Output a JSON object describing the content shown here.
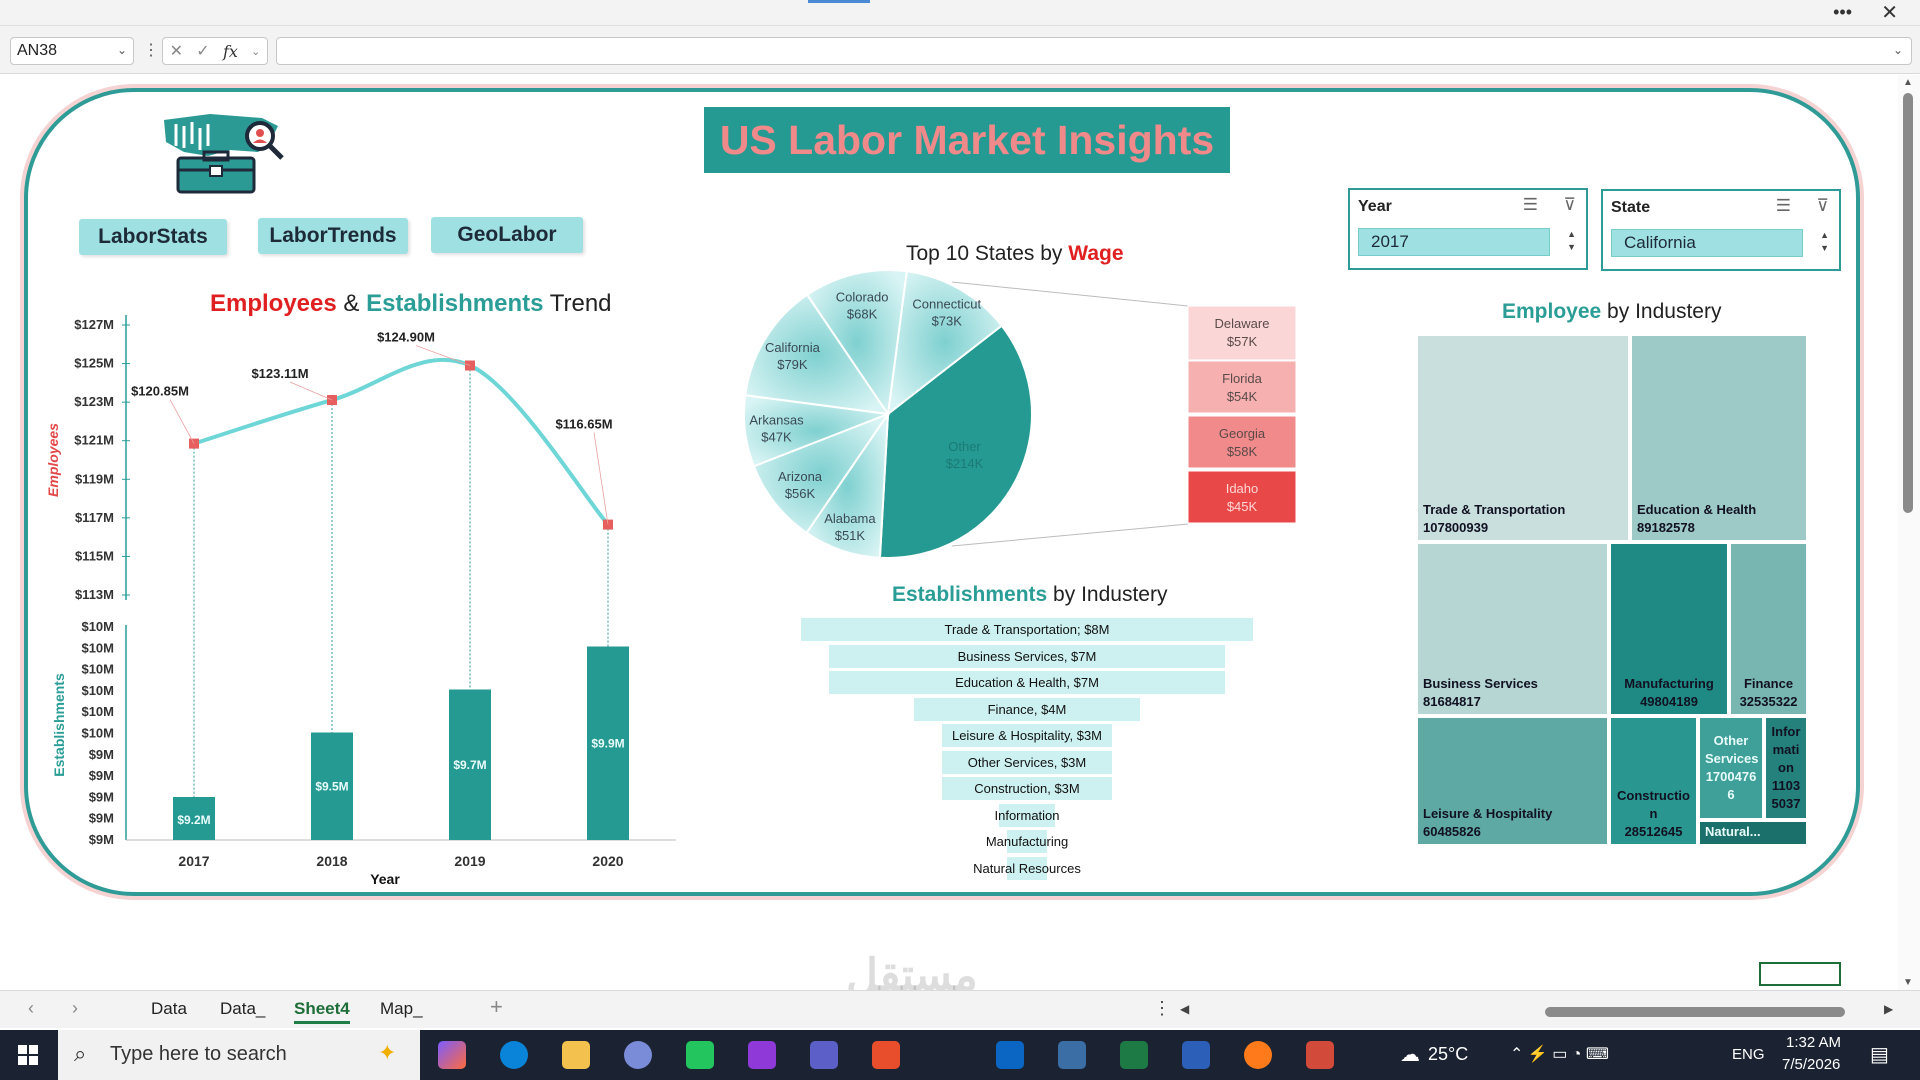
{
  "formula_bar": {
    "name_box": "AN38",
    "fx": "fx"
  },
  "dashboard": {
    "title": "US Labor Market Insights",
    "nav_buttons": [
      "LaborStats",
      "LaborTrends",
      "GeoLabor"
    ],
    "trend_title": {
      "part1": "Employees",
      "amp": " & ",
      "part2": "Establishments",
      "part3": " Trend"
    },
    "pie_title": {
      "part1": "Top 10 States by ",
      "part2": "Wage"
    },
    "funnel_title": {
      "part1": "Establishments",
      "part2": " by Industery"
    },
    "treemap_title": {
      "part1": "Employee",
      "part2": " by Industery"
    },
    "slicers": {
      "year": {
        "label": "Year",
        "value": "2017"
      },
      "state": {
        "label": "State",
        "value": "California"
      }
    }
  },
  "chart_data": [
    {
      "type": "line",
      "title": "Employees & Establishments Trend",
      "xlabel": "Year",
      "ylabel": "Employees",
      "categories": [
        "2017",
        "2018",
        "2019",
        "2020"
      ],
      "values": [
        120.85,
        123.11,
        124.9,
        116.65
      ],
      "data_labels": [
        "$120.85M",
        "$123.11M",
        "$124.90M",
        "$116.65M"
      ],
      "ylim": [
        113,
        127
      ],
      "y_ticks": [
        "$127M",
        "$125M",
        "$123M",
        "$121M",
        "$119M",
        "$117M",
        "$115M",
        "$113M"
      ]
    },
    {
      "type": "bar",
      "xlabel": "Year",
      "ylabel": "Establishments",
      "categories": [
        "2017",
        "2018",
        "2019",
        "2020"
      ],
      "values": [
        9.2,
        9.5,
        9.7,
        9.9
      ],
      "data_labels": [
        "$9.2M",
        "$9.5M",
        "$9.7M",
        "$9.9M"
      ],
      "ylim": [
        9.0,
        10.0
      ],
      "y_ticks": [
        "$10M",
        "$10M",
        "$10M",
        "$10M",
        "$10M",
        "$10M",
        "$9M",
        "$9M",
        "$9M",
        "$9M",
        "$9M"
      ]
    },
    {
      "type": "pie",
      "title": "Top 10 States by Wage",
      "slices": [
        {
          "label": "Connecticut",
          "value_label": "$73K",
          "value": 73
        },
        {
          "label": "Other",
          "value_label": "$214K",
          "value": 214
        },
        {
          "label": "Alabama",
          "value_label": "$51K",
          "value": 51
        },
        {
          "label": "Arizona",
          "value_label": "$56K",
          "value": 56
        },
        {
          "label": "Arkansas",
          "value_label": "$47K",
          "value": 47
        },
        {
          "label": "California",
          "value_label": "$79K",
          "value": 79
        },
        {
          "label": "Colorado",
          "value_label": "$68K",
          "value": 68
        }
      ],
      "other_breakdown": [
        {
          "label": "Delaware",
          "value_label": "$57K",
          "value": 57,
          "color": "#fbd6d6"
        },
        {
          "label": "Florida",
          "value_label": "$54K",
          "value": 54,
          "color": "#f7b0b0"
        },
        {
          "label": "Georgia",
          "value_label": "$58K",
          "value": 58,
          "color": "#f18a8a"
        },
        {
          "label": "Idaho",
          "value_label": "$45K",
          "value": 45,
          "color": "#e94848"
        }
      ]
    },
    {
      "type": "bar",
      "title": "Establishments by Industery",
      "items": [
        {
          "label": "Trade & Transportation; $8M",
          "value": 8
        },
        {
          "label": "Business Services, $7M",
          "value": 7
        },
        {
          "label": "Education & Health, $7M",
          "value": 7
        },
        {
          "label": "Finance, $4M",
          "value": 4
        },
        {
          "label": "Leisure & Hospitality, $3M",
          "value": 3
        },
        {
          "label": "Other Services, $3M",
          "value": 3
        },
        {
          "label": "Construction, $3M",
          "value": 3
        },
        {
          "label": "Information",
          "value": 1
        },
        {
          "label": "Manufacturing",
          "value": 0.6
        },
        {
          "label": "Natural Resources",
          "value": 0.3
        }
      ]
    },
    {
      "type": "table",
      "title": "Employee by Industery",
      "items": [
        {
          "label": "Trade & Transportation",
          "value": "107800939",
          "color": "#c8dfdd"
        },
        {
          "label": "Education & Health",
          "value": "89182578",
          "color": "#9dc9c6"
        },
        {
          "label": "Business Services",
          "value": "81684817",
          "color": "#b5d6d3"
        },
        {
          "label": "Manufacturing",
          "value": "49804189",
          "color": "#1f8a84"
        },
        {
          "label": "Finance",
          "value": "32535322",
          "color": "#78b6b2"
        },
        {
          "label": "Leisure & Hospitality",
          "value": "60485826",
          "color": "#5fa9a4"
        },
        {
          "label": "Constructio n",
          "value": "28512645",
          "color": "#2a9690"
        },
        {
          "label": "Other Services",
          "value": "1700476 6",
          "color": "#3f9f99"
        },
        {
          "label": "Infor mati on",
          "value": "1103 5037",
          "color": "#24817c"
        },
        {
          "label": "Natural...",
          "value": "",
          "color": "#1c706b"
        }
      ]
    }
  ],
  "tabs": [
    "Data",
    "Data_",
    "Sheet4",
    "Map_"
  ],
  "active_tab": "Sheet4",
  "taskbar": {
    "search_placeholder": "Type here to search",
    "temperature": "25°C",
    "language": "ENG",
    "time": "1:32 AM",
    "date": "7/5/2026"
  }
}
